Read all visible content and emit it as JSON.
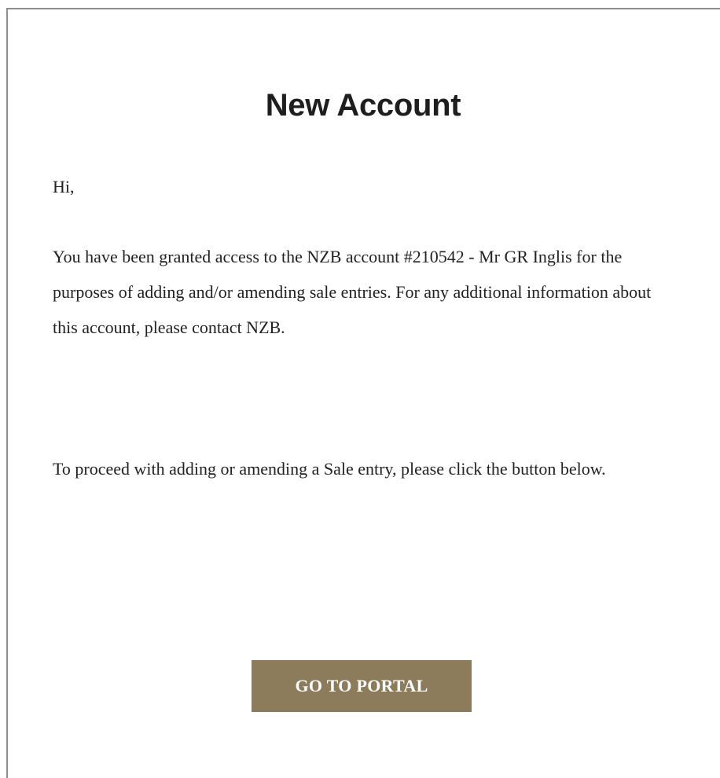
{
  "email": {
    "title": "New Account",
    "greeting": "Hi,",
    "body_access": "You have been granted access to the NZB account #210542 - Mr GR Inglis for the purposes of adding and/or amending sale entries. For any additional information about this account, please contact NZB.",
    "body_proceed": "To proceed with adding or amending a Sale entry, please click the button below.",
    "button_label": "GO TO PORTAL"
  },
  "colors": {
    "button_background": "#8c7c5b",
    "button_text": "#ffffff",
    "title_text": "#1e1e1e",
    "body_text": "#222222",
    "frame_border": "#8f8f8f"
  }
}
